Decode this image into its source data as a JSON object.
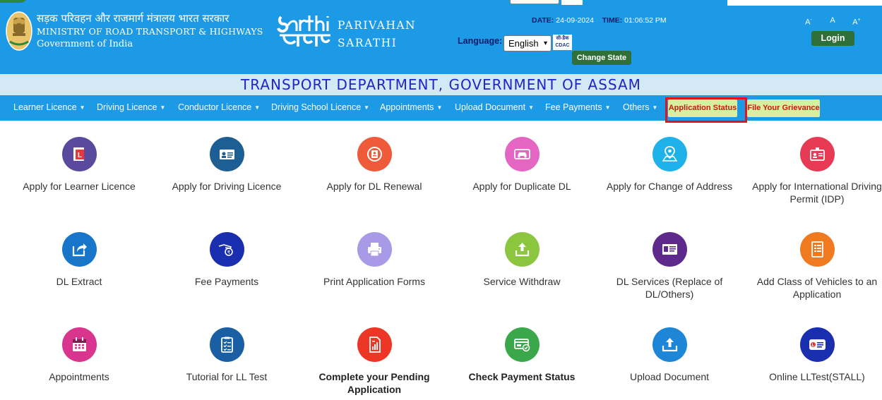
{
  "header": {
    "ministry_hindi": "सड़क परिवहन और राजमार्ग मंत्रालय भारत सरकार",
    "ministry_english": "MINISTRY OF ROAD TRANSPORT & HIGHWAYS",
    "government": "Government of India",
    "parivahan": "PARIVAHAN",
    "sarathi": "SARATHI",
    "date_label": "DATE:",
    "date_value": "24-09-2024",
    "time_label": "TIME:",
    "time_value": "01:06:52 PM",
    "language_label": "Language:",
    "language_selected": "English",
    "cdac_hindi": "सी-डैक",
    "cdac_text": "CDAC",
    "change_state": "Change State",
    "font_decrease": "A-",
    "font_normal": "A",
    "font_increase": "A+",
    "login": "Login",
    "header_bg": "#1d9ae6"
  },
  "department": {
    "title": "TRANSPORT DEPARTMENT, GOVERNMENT OF ASSAM"
  },
  "nav": {
    "items": [
      {
        "label": "Learner Licence"
      },
      {
        "label": "Driving Licence"
      },
      {
        "label": "Conductor Licence"
      },
      {
        "label": "Driving School Licence"
      },
      {
        "label": "Appointments"
      },
      {
        "label": "Upload Document"
      },
      {
        "label": "Fee Payments"
      },
      {
        "label": "Others"
      }
    ],
    "application_status": "Application Status",
    "grievance": "File Your Grievance"
  },
  "services": [
    {
      "label": "Apply for Learner Licence",
      "icon": "learner-licence-icon",
      "color": "#5a4a9e"
    },
    {
      "label": "Apply for Driving Licence",
      "icon": "driving-licence-icon",
      "color": "#1d5e95"
    },
    {
      "label": "Apply for DL Renewal",
      "icon": "dl-renewal-icon",
      "color": "#ef5a3a"
    },
    {
      "label": "Apply for Duplicate DL",
      "icon": "duplicate-dl-icon",
      "color": "#e466c2"
    },
    {
      "label": "Apply for Change of Address",
      "icon": "change-address-icon",
      "color": "#1fb1ea"
    },
    {
      "label": "Apply for International Driving Permit (IDP)",
      "icon": "idp-icon",
      "color": "#e63a55"
    },
    {
      "label": "DL Extract",
      "icon": "dl-extract-icon",
      "color": "#1776c9"
    },
    {
      "label": "Fee Payments",
      "icon": "fee-payment-icon",
      "color": "#1a2fb0"
    },
    {
      "label": "Print Application Forms",
      "icon": "print-icon",
      "color": "#a89ae6"
    },
    {
      "label": "Service Withdraw",
      "icon": "service-withdraw-icon",
      "color": "#8cc63f"
    },
    {
      "label": "DL Services (Replace of DL/Others)",
      "icon": "dl-services-icon",
      "color": "#5d2a8c"
    },
    {
      "label": "Add Class of Vehicles to an Application",
      "icon": "add-class-icon",
      "color": "#f07a20"
    },
    {
      "label": "Appointments",
      "icon": "appointments-icon",
      "color": "#d9358f"
    },
    {
      "label": "Tutorial for LL Test",
      "icon": "tutorial-icon",
      "color": "#1a5fa3"
    },
    {
      "label": "Complete your Pending Application",
      "icon": "pending-application-icon",
      "color": "#ec3626"
    },
    {
      "label": "Check Payment Status",
      "icon": "payment-status-icon",
      "color": "#3aa84a"
    },
    {
      "label": "Upload Document",
      "icon": "upload-document-icon",
      "color": "#1d86d6"
    },
    {
      "label": "Online LLTest(STALL)",
      "icon": "online-lltest-icon",
      "color": "#1a2fb0"
    }
  ]
}
